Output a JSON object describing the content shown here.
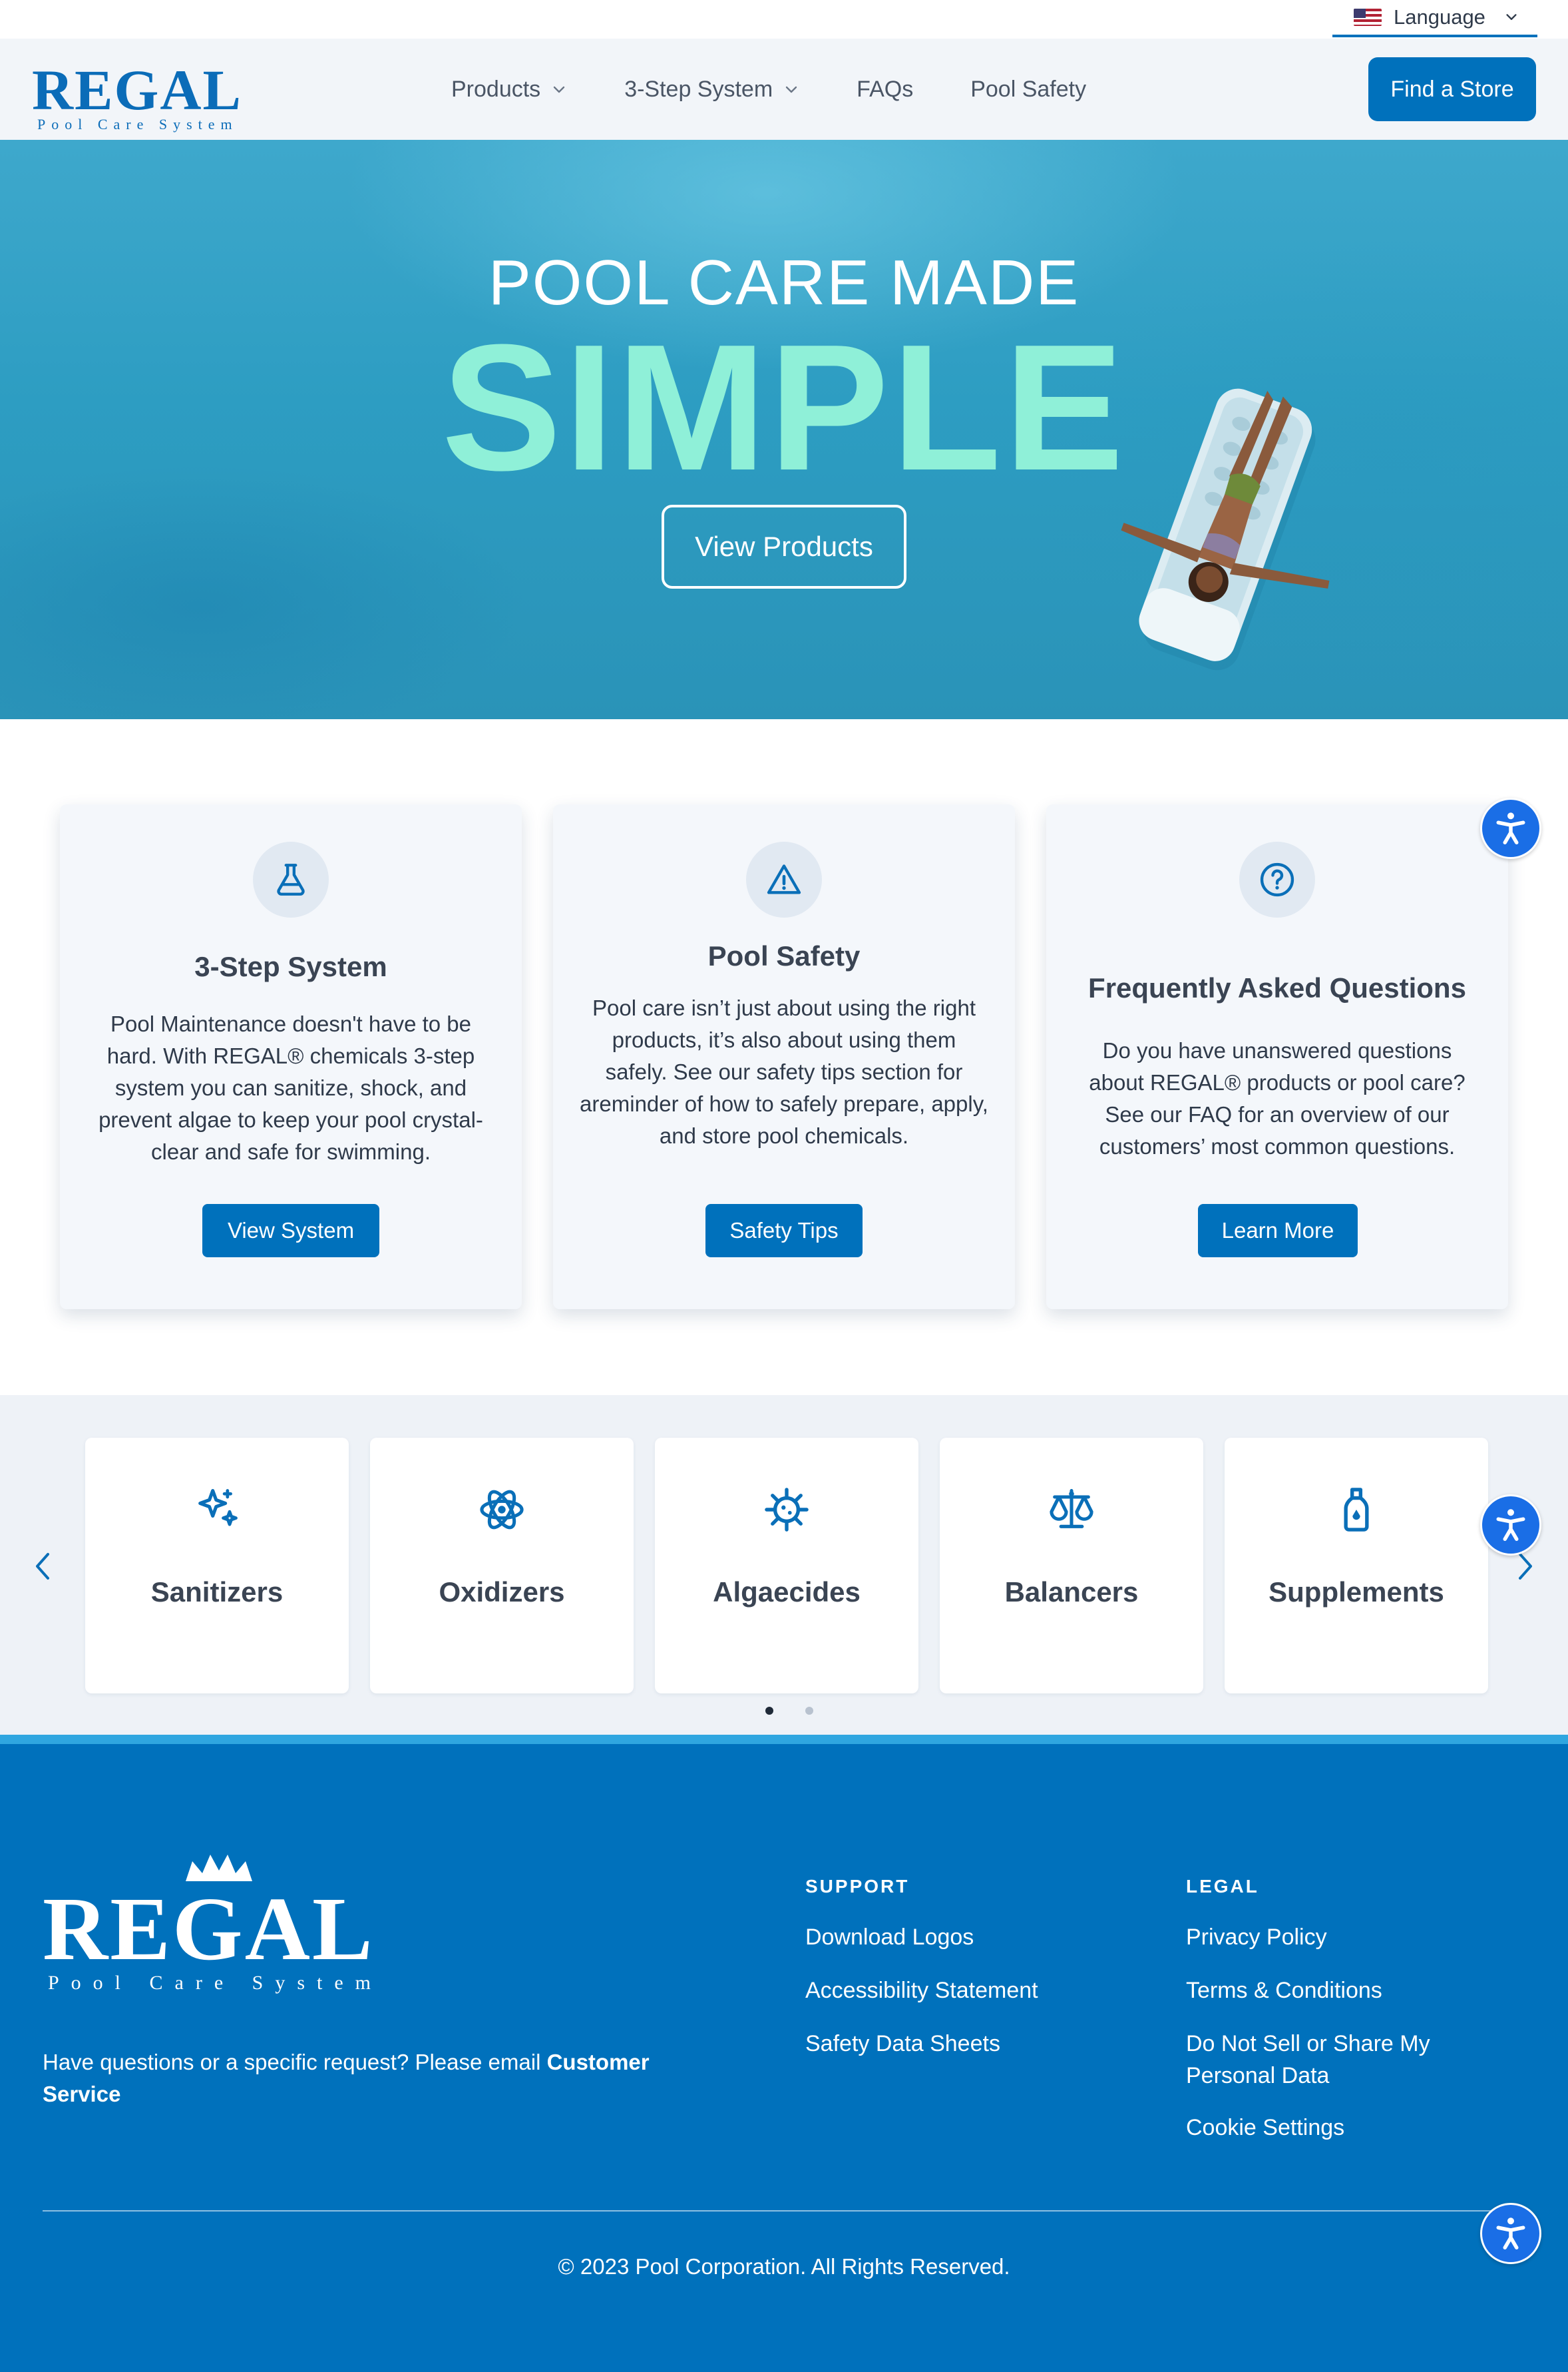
{
  "language": {
    "label": "Language",
    "flag_icon": "us-flag-icon"
  },
  "header": {
    "logo_word": "REGAL",
    "logo_sub": "Pool Care System",
    "nav": [
      {
        "label": "Products",
        "has_dropdown": true
      },
      {
        "label": "3-Step System",
        "has_dropdown": true
      },
      {
        "label": "FAQs",
        "has_dropdown": false
      },
      {
        "label": "Pool Safety",
        "has_dropdown": false
      }
    ],
    "cta": "Find a Store"
  },
  "hero": {
    "line1": "POOL CARE MADE",
    "line2": "SIMPLE",
    "button": "View Products"
  },
  "features": [
    {
      "icon": "flask-icon",
      "title": "3-Step System",
      "text": "Pool Maintenance doesn't have to be hard. With REGAL® chemicals 3-step system you can sanitize, shock, and prevent algae to keep your pool crystal-clear and safe for swimming.",
      "button": "View System"
    },
    {
      "icon": "warning-icon",
      "title": "Pool Safety",
      "text": "Pool care isn’t just about using the right products, it’s also about using them safely. See our safety tips section for areminder of how to safely prepare, apply, and store pool chemicals.",
      "button": "Safety Tips"
    },
    {
      "icon": "question-icon",
      "title": "Frequently Asked Questions",
      "text": "Do you have unanswered questions about REGAL® products or pool care? See our FAQ for an overview of our customers’ most common questions.",
      "button": "Learn More"
    }
  ],
  "categories": [
    {
      "label": "Sanitizers",
      "icon": "sparkles-icon"
    },
    {
      "label": "Oxidizers",
      "icon": "atom-icon"
    },
    {
      "label": "Algaecides",
      "icon": "virus-icon"
    },
    {
      "label": "Balancers",
      "icon": "scale-icon"
    },
    {
      "label": "Supplements",
      "icon": "bottle-icon"
    }
  ],
  "carousel": {
    "pages": 2,
    "active_page": 1
  },
  "footer": {
    "logo_word": "REGAL",
    "logo_sub": "Pool Care System",
    "contact_text": "Have questions or a specific request? Please email ",
    "contact_link": "Customer Service",
    "support": {
      "heading": "SUPPORT",
      "links": [
        "Download Logos",
        "Accessibility Statement",
        "Safety Data Sheets"
      ]
    },
    "legal": {
      "heading": "LEGAL",
      "links": [
        "Privacy Policy",
        "Terms & Conditions",
        "Do Not Sell or Share My Personal Data",
        "Cookie Settings"
      ]
    },
    "copyright": "© 2023 Pool Corporation. All Rights Reserved."
  },
  "colors": {
    "brand_blue": "#0071bc",
    "hero_water": "#2d9dc2",
    "hero_accent": "#8ff0d8",
    "footer_band": "#2fa6e0",
    "accessibility_button": "#1a6ee6"
  }
}
